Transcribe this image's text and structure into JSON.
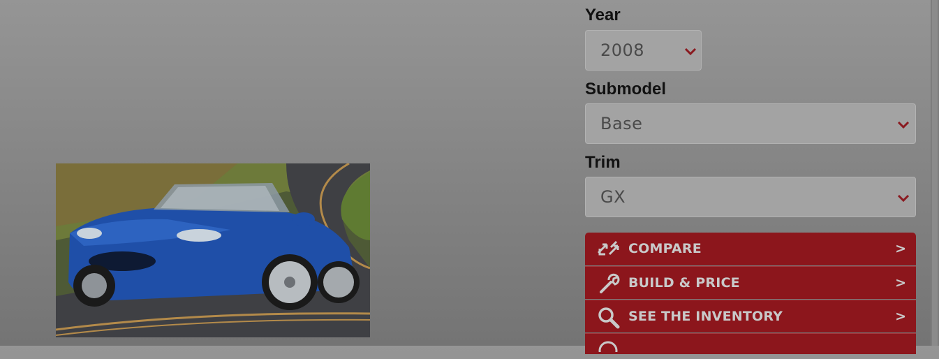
{
  "vehicle_selector": {
    "year": {
      "label": "Year",
      "value": "2008"
    },
    "submodel": {
      "label": "Submodel",
      "value": "Base"
    },
    "trim": {
      "label": "Trim",
      "value": "GX"
    }
  },
  "actions": [
    {
      "label": "COMPARE",
      "icon": "compare-arrows-icon",
      "arrow": ">"
    },
    {
      "label": "BUILD & PRICE",
      "icon": "wrench-icon",
      "arrow": ">"
    },
    {
      "label": "SEE THE INVENTORY",
      "icon": "search-icon",
      "arrow": ">"
    }
  ],
  "colors": {
    "overlay": "#8a8a8a",
    "action_button": "#8c161c",
    "chevron": "#8a1a20",
    "car_paint": "#1f4fa8"
  }
}
